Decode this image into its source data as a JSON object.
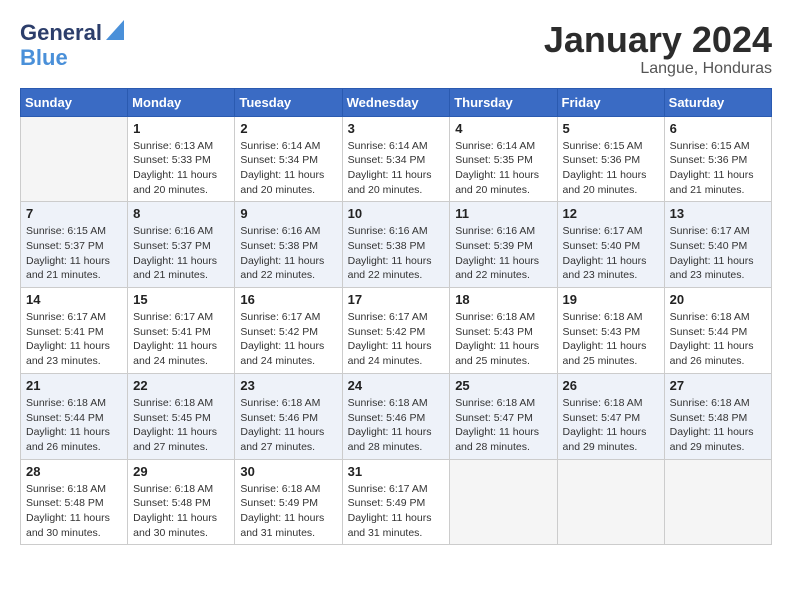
{
  "header": {
    "logo_line1a": "General",
    "logo_line1b": "Blue",
    "month_title": "January 2024",
    "location": "Langue, Honduras"
  },
  "weekdays": [
    "Sunday",
    "Monday",
    "Tuesday",
    "Wednesday",
    "Thursday",
    "Friday",
    "Saturday"
  ],
  "weeks": [
    [
      {
        "day": "",
        "sunrise": "",
        "sunset": "",
        "daylight": ""
      },
      {
        "day": "1",
        "sunrise": "Sunrise: 6:13 AM",
        "sunset": "Sunset: 5:33 PM",
        "daylight": "Daylight: 11 hours and 20 minutes."
      },
      {
        "day": "2",
        "sunrise": "Sunrise: 6:14 AM",
        "sunset": "Sunset: 5:34 PM",
        "daylight": "Daylight: 11 hours and 20 minutes."
      },
      {
        "day": "3",
        "sunrise": "Sunrise: 6:14 AM",
        "sunset": "Sunset: 5:34 PM",
        "daylight": "Daylight: 11 hours and 20 minutes."
      },
      {
        "day": "4",
        "sunrise": "Sunrise: 6:14 AM",
        "sunset": "Sunset: 5:35 PM",
        "daylight": "Daylight: 11 hours and 20 minutes."
      },
      {
        "day": "5",
        "sunrise": "Sunrise: 6:15 AM",
        "sunset": "Sunset: 5:36 PM",
        "daylight": "Daylight: 11 hours and 20 minutes."
      },
      {
        "day": "6",
        "sunrise": "Sunrise: 6:15 AM",
        "sunset": "Sunset: 5:36 PM",
        "daylight": "Daylight: 11 hours and 21 minutes."
      }
    ],
    [
      {
        "day": "7",
        "sunrise": "Sunrise: 6:15 AM",
        "sunset": "Sunset: 5:37 PM",
        "daylight": "Daylight: 11 hours and 21 minutes."
      },
      {
        "day": "8",
        "sunrise": "Sunrise: 6:16 AM",
        "sunset": "Sunset: 5:37 PM",
        "daylight": "Daylight: 11 hours and 21 minutes."
      },
      {
        "day": "9",
        "sunrise": "Sunrise: 6:16 AM",
        "sunset": "Sunset: 5:38 PM",
        "daylight": "Daylight: 11 hours and 22 minutes."
      },
      {
        "day": "10",
        "sunrise": "Sunrise: 6:16 AM",
        "sunset": "Sunset: 5:38 PM",
        "daylight": "Daylight: 11 hours and 22 minutes."
      },
      {
        "day": "11",
        "sunrise": "Sunrise: 6:16 AM",
        "sunset": "Sunset: 5:39 PM",
        "daylight": "Daylight: 11 hours and 22 minutes."
      },
      {
        "day": "12",
        "sunrise": "Sunrise: 6:17 AM",
        "sunset": "Sunset: 5:40 PM",
        "daylight": "Daylight: 11 hours and 23 minutes."
      },
      {
        "day": "13",
        "sunrise": "Sunrise: 6:17 AM",
        "sunset": "Sunset: 5:40 PM",
        "daylight": "Daylight: 11 hours and 23 minutes."
      }
    ],
    [
      {
        "day": "14",
        "sunrise": "Sunrise: 6:17 AM",
        "sunset": "Sunset: 5:41 PM",
        "daylight": "Daylight: 11 hours and 23 minutes."
      },
      {
        "day": "15",
        "sunrise": "Sunrise: 6:17 AM",
        "sunset": "Sunset: 5:41 PM",
        "daylight": "Daylight: 11 hours and 24 minutes."
      },
      {
        "day": "16",
        "sunrise": "Sunrise: 6:17 AM",
        "sunset": "Sunset: 5:42 PM",
        "daylight": "Daylight: 11 hours and 24 minutes."
      },
      {
        "day": "17",
        "sunrise": "Sunrise: 6:17 AM",
        "sunset": "Sunset: 5:42 PM",
        "daylight": "Daylight: 11 hours and 24 minutes."
      },
      {
        "day": "18",
        "sunrise": "Sunrise: 6:18 AM",
        "sunset": "Sunset: 5:43 PM",
        "daylight": "Daylight: 11 hours and 25 minutes."
      },
      {
        "day": "19",
        "sunrise": "Sunrise: 6:18 AM",
        "sunset": "Sunset: 5:43 PM",
        "daylight": "Daylight: 11 hours and 25 minutes."
      },
      {
        "day": "20",
        "sunrise": "Sunrise: 6:18 AM",
        "sunset": "Sunset: 5:44 PM",
        "daylight": "Daylight: 11 hours and 26 minutes."
      }
    ],
    [
      {
        "day": "21",
        "sunrise": "Sunrise: 6:18 AM",
        "sunset": "Sunset: 5:44 PM",
        "daylight": "Daylight: 11 hours and 26 minutes."
      },
      {
        "day": "22",
        "sunrise": "Sunrise: 6:18 AM",
        "sunset": "Sunset: 5:45 PM",
        "daylight": "Daylight: 11 hours and 27 minutes."
      },
      {
        "day": "23",
        "sunrise": "Sunrise: 6:18 AM",
        "sunset": "Sunset: 5:46 PM",
        "daylight": "Daylight: 11 hours and 27 minutes."
      },
      {
        "day": "24",
        "sunrise": "Sunrise: 6:18 AM",
        "sunset": "Sunset: 5:46 PM",
        "daylight": "Daylight: 11 hours and 28 minutes."
      },
      {
        "day": "25",
        "sunrise": "Sunrise: 6:18 AM",
        "sunset": "Sunset: 5:47 PM",
        "daylight": "Daylight: 11 hours and 28 minutes."
      },
      {
        "day": "26",
        "sunrise": "Sunrise: 6:18 AM",
        "sunset": "Sunset: 5:47 PM",
        "daylight": "Daylight: 11 hours and 29 minutes."
      },
      {
        "day": "27",
        "sunrise": "Sunrise: 6:18 AM",
        "sunset": "Sunset: 5:48 PM",
        "daylight": "Daylight: 11 hours and 29 minutes."
      }
    ],
    [
      {
        "day": "28",
        "sunrise": "Sunrise: 6:18 AM",
        "sunset": "Sunset: 5:48 PM",
        "daylight": "Daylight: 11 hours and 30 minutes."
      },
      {
        "day": "29",
        "sunrise": "Sunrise: 6:18 AM",
        "sunset": "Sunset: 5:48 PM",
        "daylight": "Daylight: 11 hours and 30 minutes."
      },
      {
        "day": "30",
        "sunrise": "Sunrise: 6:18 AM",
        "sunset": "Sunset: 5:49 PM",
        "daylight": "Daylight: 11 hours and 31 minutes."
      },
      {
        "day": "31",
        "sunrise": "Sunrise: 6:17 AM",
        "sunset": "Sunset: 5:49 PM",
        "daylight": "Daylight: 11 hours and 31 minutes."
      },
      {
        "day": "",
        "sunrise": "",
        "sunset": "",
        "daylight": ""
      },
      {
        "day": "",
        "sunrise": "",
        "sunset": "",
        "daylight": ""
      },
      {
        "day": "",
        "sunrise": "",
        "sunset": "",
        "daylight": ""
      }
    ]
  ]
}
